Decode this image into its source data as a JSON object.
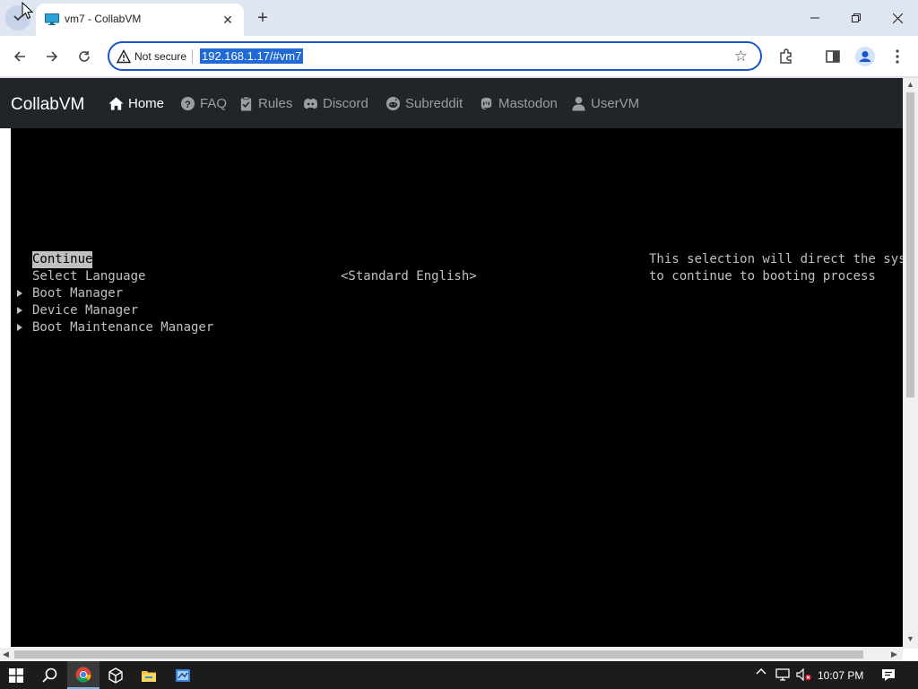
{
  "browser": {
    "tab_title": "vm7 - CollabVM",
    "security_label": "Not secure",
    "url": "192.168.1.17/#vm7",
    "new_tab_symbol": "+"
  },
  "site": {
    "brand": "CollabVM",
    "nav": [
      {
        "label": "Home",
        "icon": "home-icon",
        "active": true
      },
      {
        "label": "FAQ",
        "icon": "question-circle-icon"
      },
      {
        "label": "Rules",
        "icon": "clipboard-check-icon"
      },
      {
        "label": "Discord",
        "icon": "discord-icon"
      },
      {
        "label": "Subreddit",
        "icon": "reddit-icon"
      },
      {
        "label": "Mastodon",
        "icon": "mastodon-icon"
      },
      {
        "label": "UserVM",
        "icon": "user-icon"
      }
    ]
  },
  "vm": {
    "menu": [
      {
        "label": "Continue",
        "selected": true,
        "submenu": false
      },
      {
        "label": "Select Language",
        "value": "<Standard English>",
        "submenu": false
      },
      {
        "label": "Boot Manager",
        "submenu": true
      },
      {
        "label": "Device Manager",
        "submenu": true
      },
      {
        "label": "Boot Maintenance Manager",
        "submenu": true
      }
    ],
    "help": [
      "This selection will direct the syste",
      "to continue to booting process"
    ]
  },
  "taskbar": {
    "time": "10:07 PM",
    "apps": [
      "start-icon",
      "search-icon",
      "chrome-icon",
      "virtualbox-icon",
      "file-explorer-icon",
      "app-icon"
    ]
  },
  "colors": {
    "navbar_bg": "#212529",
    "vm_bg": "#000000",
    "vm_text": "#c0c0c0",
    "url_highlight": "#1f6ad6",
    "omnibox_border": "#1a56c9"
  }
}
